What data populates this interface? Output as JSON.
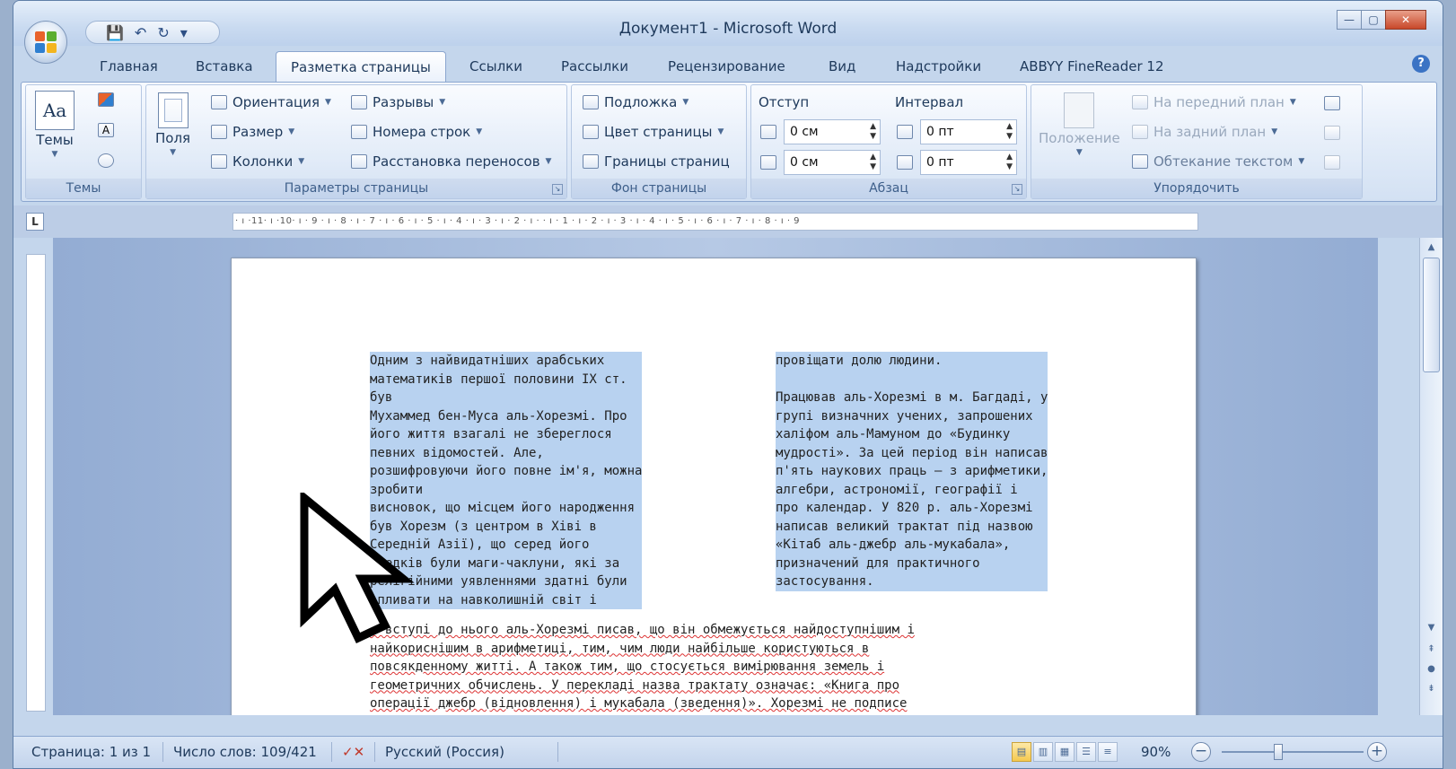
{
  "window": {
    "title": "Документ1 - Microsoft Word",
    "controls": {
      "minimize": "—",
      "maximize": "▢",
      "close": "✕"
    }
  },
  "qat": {
    "save_icon": "save-icon",
    "undo_icon": "undo-icon",
    "redo_icon": "redo-icon",
    "more": "▾"
  },
  "tabs": [
    "Главная",
    "Вставка",
    "Разметка страницы",
    "Ссылки",
    "Рассылки",
    "Рецензирование",
    "Вид",
    "Надстройки",
    "ABBYY FineReader 12"
  ],
  "active_tab": "Разметка страницы",
  "help": "?",
  "ribbon": {
    "themes": {
      "button": "Темы",
      "group": "Темы"
    },
    "page_setup": {
      "fields": "Поля",
      "orientation": "Ориентация",
      "size": "Размер",
      "columns": "Колонки",
      "breaks": "Разрывы",
      "line_numbers": "Номера строк",
      "hyphenation": "Расстановка переносов",
      "group": "Параметры страницы"
    },
    "background": {
      "watermark": "Подложка",
      "page_color": "Цвет страницы",
      "page_borders": "Границы страниц",
      "group": "Фон страницы"
    },
    "paragraph": {
      "indent_label": "Отступ",
      "spacing_label": "Интервал",
      "indent_left": "0 см",
      "indent_right": "0 см",
      "spacing_before": "0 пт",
      "spacing_after": "0 пт",
      "group": "Абзац"
    },
    "arrange": {
      "position": "Положение",
      "bring_front": "На передний план",
      "send_back": "На задний план",
      "text_wrap": "Обтекание текстом",
      "group": "Упорядочить"
    }
  },
  "ruler": {
    "text": "· ı ·11· ı ·10· ı · 9 · ı · 8 · ı · 7 · ı · 6 · ı · 5 · ı · 4 · ı · 3 · ı · 2 · ı  ·    ·  ı · 1 · ı · 2 · ı · 3 · ı · 4 · ı · 5 · ı · 6 · ı · 7 · ı · 8 · ı · 9"
  },
  "document": {
    "left_column": [
      "Одним з найвидатніших арабських",
      "математиків першої половини IX ст.",
      "був",
      "Мухаммед бен-Муса аль-Хорезмі. Про",
      "його життя взагалі не збереглося",
      "певних відомостей. Але,",
      "розшифровуючи його повне ім'я, можна",
      "зробити",
      "висновок, що місцем його народження",
      "був Хорезм (з центром в Хіві в",
      "Середній Азії), що серед його",
      "предків були маги-чаклуни, які за",
      "релігійними уявленнями здатні були",
      "впливати на навколишній світ і"
    ],
    "right_column": [
      "провіщати долю людини.",
      " ",
      "Працював аль-Хорезмі в м. Багдаді, у",
      "групі визначних учених, запрошених",
      "халіфом аль-Мамуном до «Будинку",
      "мудрості». За цей період він написав",
      "п'ять наукових праць — з арифметики,",
      "алгебри, астрономії, географії і",
      "про календар. У 820 р. аль-Хорезмі",
      "написав великий трактат під назвою",
      "«Кітаб аль-джебр аль-мукабала»,",
      "призначений для практичного",
      "застосування."
    ],
    "body": [
      "У вступі до нього аль-Хорезмі писав, що він обмежується найдоступнішим і",
      "найкориснішим в арифметиці, тим, чим люди найбільше користуються в",
      "повсякденному житті. А також тим, що стосується вимірювання земель і",
      "геометричних обчислень. У перекладі назва трактату означає: «Книга про",
      "операції джебр (відновлення) і мукабала (зведення)». Хорезмі не подписе"
    ]
  },
  "statusbar": {
    "page": "Страница: 1 из 1",
    "words": "Число слов: 109/421",
    "language": "Русский (Россия)",
    "zoom": "90%"
  }
}
